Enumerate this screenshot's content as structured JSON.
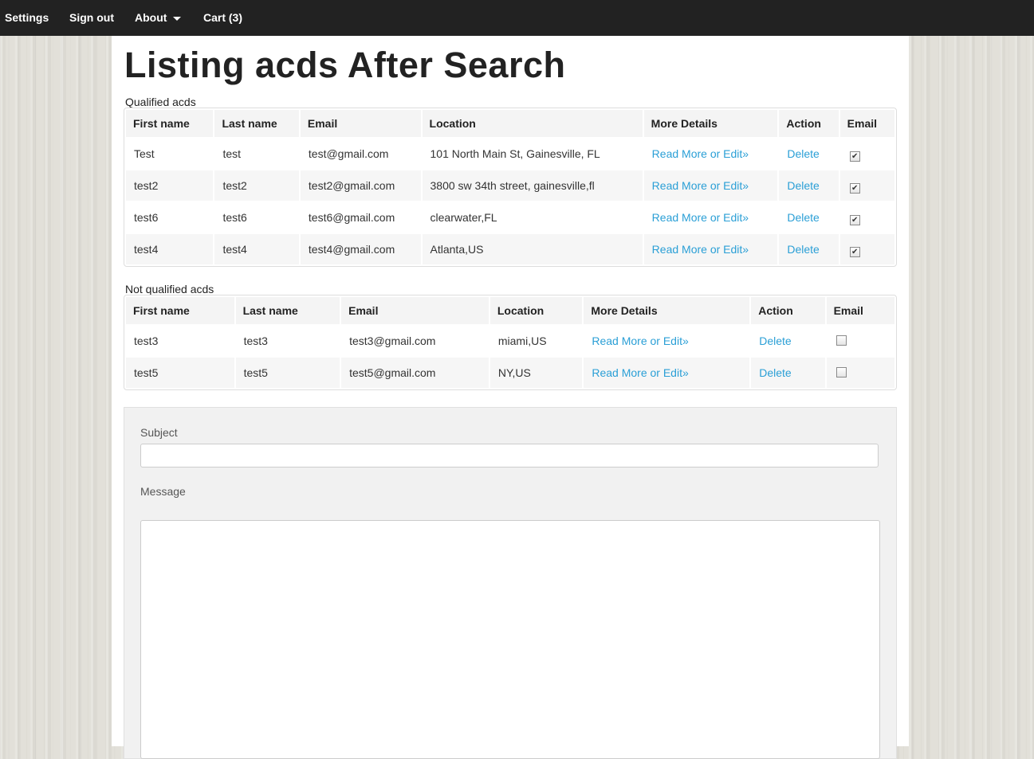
{
  "nav": {
    "settings": "Settings",
    "signout": "Sign out",
    "about": "About",
    "cart": "Cart (3)"
  },
  "page_title": "Listing acds After Search",
  "qualified": {
    "label": "Qualified acds",
    "headers": [
      "First name",
      "Last name",
      "Email",
      "Location",
      "More Details",
      "Action",
      "Email"
    ],
    "rows": [
      {
        "first": "Test",
        "last": "test",
        "email": "test@gmail.com",
        "location": "101 North Main St, Gainesville, FL",
        "details": "Read More or Edit»",
        "action": "Delete",
        "checked": true
      },
      {
        "first": "test2",
        "last": "test2",
        "email": "test2@gmail.com",
        "location": "3800 sw 34th street, gainesville,fl",
        "details": "Read More or Edit»",
        "action": "Delete",
        "checked": true
      },
      {
        "first": "test6",
        "last": "test6",
        "email": "test6@gmail.com",
        "location": "clearwater,FL",
        "details": "Read More or Edit»",
        "action": "Delete",
        "checked": true
      },
      {
        "first": "test4",
        "last": "test4",
        "email": "test4@gmail.com",
        "location": "Atlanta,US",
        "details": "Read More or Edit»",
        "action": "Delete",
        "checked": true
      }
    ]
  },
  "not_qualified": {
    "label": "Not qualified acds",
    "headers": [
      "First name",
      "Last name",
      "Email",
      "Location",
      "More Details",
      "Action",
      "Email"
    ],
    "rows": [
      {
        "first": "test3",
        "last": "test3",
        "email": "test3@gmail.com",
        "location": "miami,US",
        "details": "Read More or Edit»",
        "action": "Delete",
        "checked": false
      },
      {
        "first": "test5",
        "last": "test5",
        "email": "test5@gmail.com",
        "location": "NY,US",
        "details": "Read More or Edit»",
        "action": "Delete",
        "checked": false
      }
    ]
  },
  "form": {
    "subject_label": "Subject",
    "subject_value": "",
    "message_label": "Message",
    "message_value": ""
  },
  "colors": {
    "navbar": "#222222",
    "link": "#2a9fd6",
    "well": "#f1f1f1"
  },
  "icons": {
    "about_dropdown": "caret-down-icon",
    "checkbox": "checkbox-icon"
  }
}
